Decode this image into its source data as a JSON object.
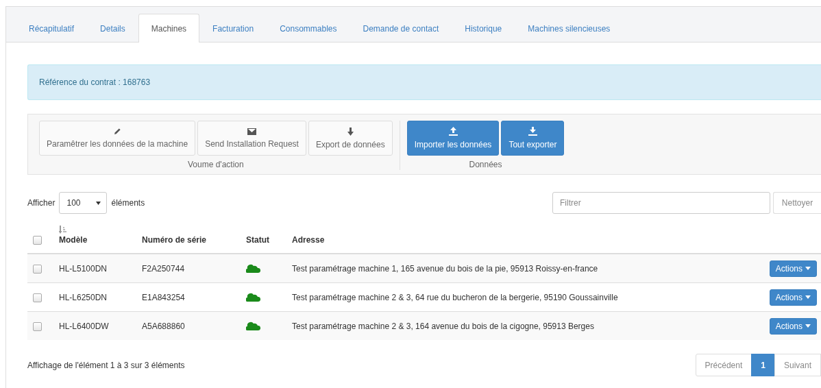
{
  "tabs": [
    {
      "label": "Récapitulatif",
      "selected": false
    },
    {
      "label": "Details",
      "selected": false
    },
    {
      "label": "Machines",
      "selected": true
    },
    {
      "label": "Facturation",
      "selected": false
    },
    {
      "label": "Consommables",
      "selected": false
    },
    {
      "label": "Demande de contact",
      "selected": false
    },
    {
      "label": "Historique",
      "selected": false
    },
    {
      "label": "Machines silencieuses",
      "selected": false
    }
  ],
  "contract_alert": "Référence du contrat : 168763",
  "action_groups": [
    {
      "label": "Voume d'action",
      "kind": "default",
      "buttons": [
        {
          "label": "Paramêtrer les données de la machine",
          "kind": "pencil"
        },
        {
          "label": "Send Installation Request",
          "kind": "envelope"
        },
        {
          "label": "Export de données",
          "kind": "arrow"
        }
      ]
    },
    {
      "label": "Données",
      "kind": "primary",
      "buttons": [
        {
          "label": "Importer les données",
          "kind": "upload"
        },
        {
          "label": "Tout exporter",
          "kind": "download"
        }
      ]
    }
  ],
  "length_menu": {
    "before": "Afficher",
    "value": "100",
    "after": "éléments"
  },
  "filter": {
    "placeholder": "Filtrer",
    "clear_button": "Nettoyer"
  },
  "table": {
    "select_all_checked": false,
    "columns": [
      {
        "label": "Modèle",
        "sortable": true
      },
      {
        "label": "Numéro de série",
        "sortable": false
      },
      {
        "label": "Statut",
        "sortable": false
      },
      {
        "label": "Adresse",
        "sortable": false
      }
    ],
    "rows": [
      {
        "checked": false,
        "model": "HL-L5100DN",
        "serial": "F2A250744",
        "color": "#1a8a1a",
        "address": "Test paramétrage machine 1, 165 avenue du bois de la pie, 95913 Roissy-en-france",
        "action": "Actions"
      },
      {
        "checked": false,
        "model": "HL-L6250DN",
        "serial": "E1A843254",
        "color": "#1a8a1a",
        "address": "Test paramétrage machine 2 & 3, 64 rue du bucheron de la bergerie, 95190 Goussainville",
        "action": "Actions"
      },
      {
        "checked": false,
        "model": "HL-L6400DW",
        "serial": "A5A688860",
        "color": "#1a8a1a",
        "address": "Test paramétrage machine 2 & 3, 164 avenue du bois de la cigogne, 95913 Berges",
        "action": "Actions"
      }
    ]
  },
  "info": "Affichage de l'élément 1 à 3 sur 3 éléments",
  "pagination": {
    "previous": "Précédent",
    "pages": [
      {
        "label": "1",
        "selected": true
      }
    ],
    "next": "Suivant"
  }
}
